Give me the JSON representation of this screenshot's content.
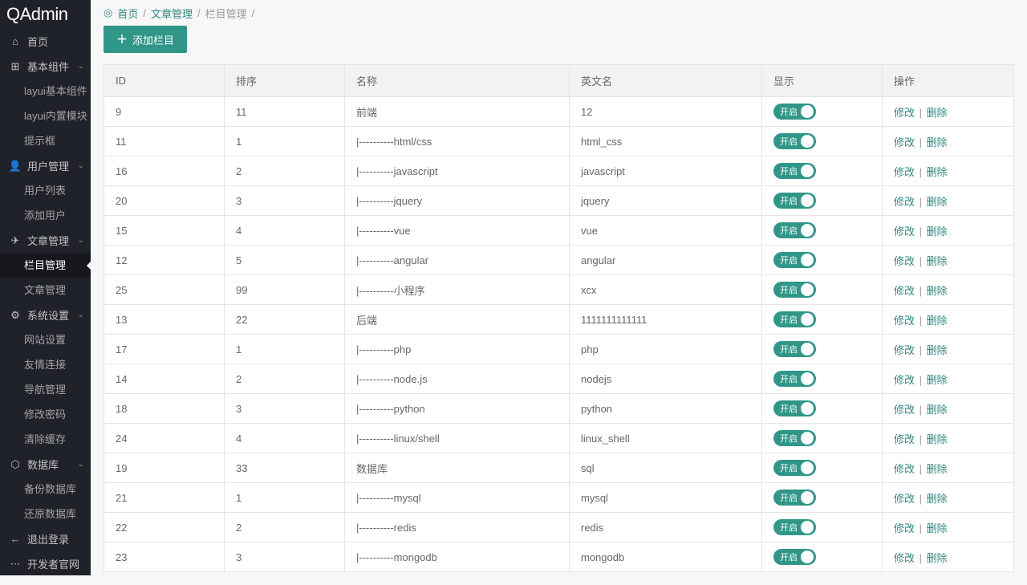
{
  "brand": "QAdmin",
  "breadcrumb": {
    "home": "首页",
    "level1": "文章管理",
    "level2": "栏目管理"
  },
  "toolbar": {
    "add_label": "添加栏目"
  },
  "sidebar": {
    "home": "首页",
    "basic": "基本组件",
    "basic_items": [
      "layui基本组件",
      "layui内置模块",
      "提示框"
    ],
    "user": "用户管理",
    "user_items": [
      "用户列表",
      "添加用户"
    ],
    "article": "文章管理",
    "article_items": [
      "栏目管理",
      "文章管理"
    ],
    "system": "系统设置",
    "system_items": [
      "网站设置",
      "友情连接",
      "导航管理",
      "修改密码",
      "清除缓存"
    ],
    "database": "数据库",
    "database_items": [
      "备份数据库",
      "还原数据库"
    ],
    "logout": "退出登录",
    "dev": "开发者官网"
  },
  "table": {
    "headers": {
      "id": "ID",
      "sort": "排序",
      "name": "名称",
      "en": "英文名",
      "show": "显示",
      "op": "操作"
    },
    "switch_label": "开启",
    "edit_label": "修改",
    "delete_label": "删除",
    "rows": [
      {
        "id": "9",
        "sort": "11",
        "name": "前端",
        "en": "12"
      },
      {
        "id": "11",
        "sort": "1",
        "name": "|----------html/css",
        "en": "html_css"
      },
      {
        "id": "16",
        "sort": "2",
        "name": "|----------javascript",
        "en": "javascript"
      },
      {
        "id": "20",
        "sort": "3",
        "name": "|----------jquery",
        "en": "jquery"
      },
      {
        "id": "15",
        "sort": "4",
        "name": "|----------vue",
        "en": "vue"
      },
      {
        "id": "12",
        "sort": "5",
        "name": "|----------angular",
        "en": "angular"
      },
      {
        "id": "25",
        "sort": "99",
        "name": "|----------小程序",
        "en": "xcx"
      },
      {
        "id": "13",
        "sort": "22",
        "name": "后端",
        "en": "1111111111111"
      },
      {
        "id": "17",
        "sort": "1",
        "name": "|----------php",
        "en": "php"
      },
      {
        "id": "14",
        "sort": "2",
        "name": "|----------node.js",
        "en": "nodejs"
      },
      {
        "id": "18",
        "sort": "3",
        "name": "|----------python",
        "en": "python"
      },
      {
        "id": "24",
        "sort": "4",
        "name": "|----------linux/shell",
        "en": "linux_shell"
      },
      {
        "id": "19",
        "sort": "33",
        "name": "数据库",
        "en": "sql"
      },
      {
        "id": "21",
        "sort": "1",
        "name": "|----------mysql",
        "en": "mysql"
      },
      {
        "id": "22",
        "sort": "2",
        "name": "|----------redis",
        "en": "redis"
      },
      {
        "id": "23",
        "sort": "3",
        "name": "|----------mongodb",
        "en": "mongodb"
      }
    ]
  }
}
